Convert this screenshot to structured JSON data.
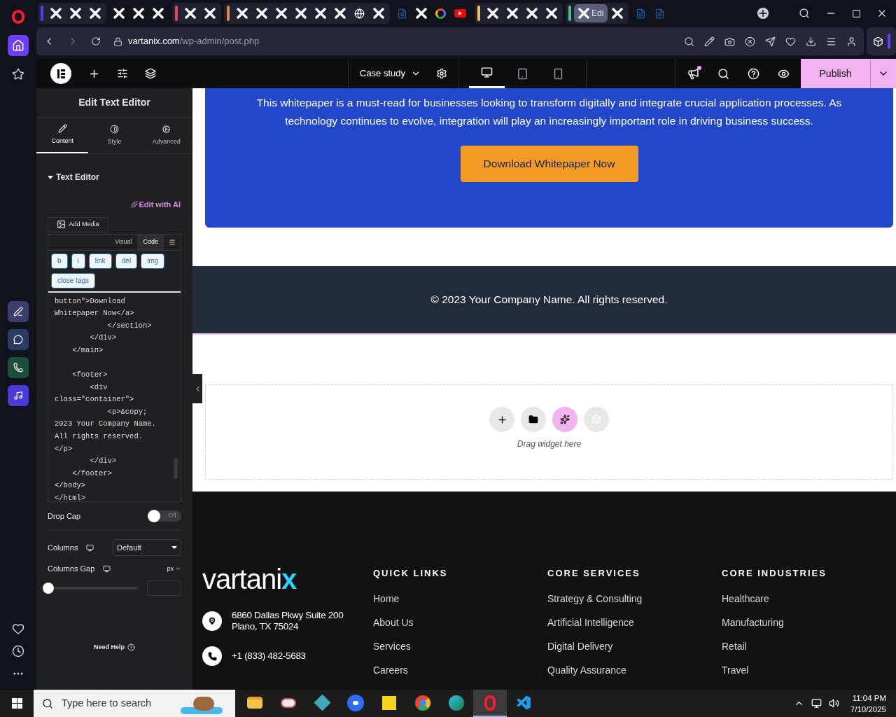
{
  "opera_sidebar": {
    "top": [
      {
        "kind": "opera",
        "selected": false
      },
      {
        "kind": "home",
        "selected": true
      },
      {
        "kind": "star",
        "selected": false
      }
    ],
    "apps": [
      {
        "kind": "aria"
      },
      {
        "kind": "messenger"
      },
      {
        "kind": "whatsapp"
      },
      {
        "kind": "music"
      }
    ],
    "bottom": [
      {
        "kind": "heart"
      },
      {
        "kind": "history"
      },
      {
        "kind": "more"
      }
    ]
  },
  "tab_groups": [
    {
      "color": "#5b3cf5",
      "tabs": [
        {
          "kind": "x",
          "selected": false
        },
        {
          "kind": "x",
          "selected": false
        },
        {
          "kind": "x",
          "selected": false
        }
      ]
    },
    {
      "tabs": [
        {
          "kind": "x",
          "selected": false
        },
        {
          "kind": "x",
          "selected": false
        },
        {
          "kind": "x",
          "selected": false
        }
      ]
    },
    {
      "color": "#e0455a",
      "tabs": [
        {
          "kind": "x",
          "selected": false
        },
        {
          "kind": "x",
          "selected": false
        }
      ]
    },
    {
      "color": "#e8834a",
      "tabs": [
        {
          "kind": "x",
          "selected": false
        },
        {
          "kind": "x",
          "selected": false
        },
        {
          "kind": "x",
          "selected": false
        },
        {
          "kind": "x",
          "selected": false
        },
        {
          "kind": "x",
          "selected": false
        },
        {
          "kind": "x",
          "selected": false
        },
        {
          "kind": "globe",
          "selected": false
        },
        {
          "kind": "x",
          "selected": false
        }
      ]
    },
    {
      "tabs": [
        {
          "kind": "doc",
          "selected": false
        },
        {
          "kind": "x",
          "selected": false
        },
        {
          "kind": "google",
          "selected": false
        },
        {
          "kind": "youtube",
          "selected": false
        }
      ]
    },
    {
      "color": "#f0c060",
      "tabs": [
        {
          "kind": "x",
          "selected": false
        },
        {
          "kind": "x",
          "selected": false
        },
        {
          "kind": "x",
          "selected": false
        },
        {
          "kind": "x",
          "selected": false
        }
      ]
    },
    {
      "color": "#4fbf8a",
      "tabs": [
        {
          "kind": "x",
          "selected": true,
          "label": "Edi"
        },
        {
          "kind": "x",
          "selected": false
        }
      ]
    },
    {
      "tabs": [
        {
          "kind": "doc",
          "selected": false
        },
        {
          "kind": "doc",
          "selected": false
        }
      ]
    }
  ],
  "address_bar": {
    "domain": "vartanix.com",
    "path": "/wp-admin/post.php"
  },
  "editor_bar": {
    "page_title": "Case study",
    "devices": [
      {
        "kind": "desktop",
        "selected": true
      },
      {
        "kind": "tablet",
        "selected": false
      },
      {
        "kind": "mobile",
        "selected": false
      }
    ],
    "notification": true,
    "publish": "Publish"
  },
  "panel": {
    "title": "Edit Text Editor",
    "tabs": [
      {
        "kind": "content",
        "label": "Content",
        "selected": true
      },
      {
        "kind": "style",
        "label": "Style",
        "selected": false
      },
      {
        "kind": "advanced",
        "label": "Advanced",
        "selected": false
      }
    ],
    "section": {
      "title": "Text Editor",
      "expanded": true
    },
    "edit_with_ai": "Edit with AI",
    "add_media": "Add Media",
    "editor_tabs": [
      {
        "label": "Visual",
        "selected": false
      },
      {
        "label": "Code",
        "selected": true
      }
    ],
    "quicktags": [
      "b",
      "i",
      "link",
      "del",
      "img",
      "close tags"
    ],
    "code_blocks": [
      [
        "button\">Download",
        "Whitepaper Now</a>",
        "            </section>",
        "        </div>",
        "    </main>"
      ],
      [
        "    <footer>",
        "        <div",
        "class=\"container\">",
        "            <p>&copy;",
        "2023 Your Company Name.",
        "All rights reserved.",
        "</p>",
        "        </div>",
        "    </footer>",
        "</body>",
        "</html>"
      ]
    ],
    "drop_cap": {
      "label": "Drop Cap",
      "on": false,
      "state_label": "Off"
    },
    "columns": {
      "label": "Columns",
      "value": "Default"
    },
    "columns_gap": {
      "label": "Columns Gap",
      "unit": "px",
      "level": 0
    },
    "help": "Need Help"
  },
  "canvas": {
    "hero_text": "This whitepaper is a must-read for businesses looking to transform digitally and integrate crucial application processes. As technology continues to evolve, integration will play an increasingly important role in driving business success.",
    "hero_button": "Download Whitepaper Now",
    "copyright": "© 2023 Your Company Name. All rights reserved.",
    "drop_zone": {
      "hint": "Drag widget here"
    },
    "footer": {
      "logo": {
        "text": "vartani",
        "accent": "x"
      },
      "address": [
        "6860 Dallas Pkwy Suite 200",
        "Plano, TX 75024"
      ],
      "phone": "+1 (833) 482-5683",
      "columns": [
        {
          "heading": "QUICK LINKS",
          "links": [
            "Home",
            "About Us",
            "Services",
            "Careers"
          ]
        },
        {
          "heading": "CORE SERVICES",
          "links": [
            "Strategy & Consulting",
            "Artificial Intelligence",
            "Digital Delivery",
            "Quality Assurance"
          ]
        },
        {
          "heading": "CORE INDUSTRIES",
          "links": [
            "Healthcare",
            "Manufacturing",
            "Retail",
            "Travel"
          ]
        }
      ]
    }
  },
  "taskbar": {
    "search_placeholder": "Type here to search",
    "apps": [
      {
        "kind": "explorer",
        "selected": false
      },
      {
        "kind": "snip",
        "selected": false
      },
      {
        "kind": "cube",
        "selected": false
      },
      {
        "kind": "zoom",
        "selected": false
      },
      {
        "kind": "notes",
        "selected": false
      },
      {
        "kind": "chrome",
        "selected": false
      },
      {
        "kind": "edge",
        "selected": false
      },
      {
        "kind": "opera",
        "selected": true
      },
      {
        "kind": "vscode",
        "selected": false
      }
    ],
    "time": "11:04 PM",
    "date": "7/10/2025"
  }
}
